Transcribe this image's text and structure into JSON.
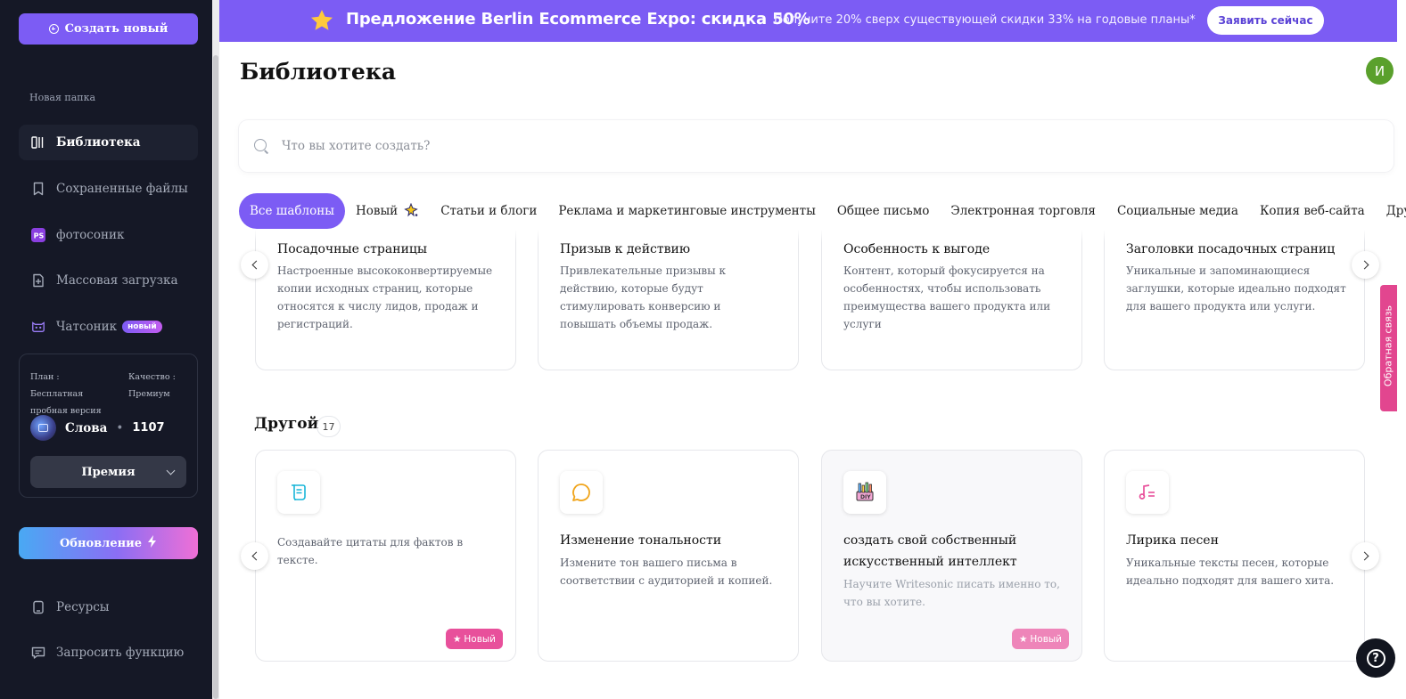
{
  "sidebar": {
    "create_button": "Создать новый",
    "folder_label": "Новая папка",
    "nav": [
      {
        "label": "Библиотека",
        "icon": "library-icon"
      },
      {
        "label": "Сохраненные файлы",
        "icon": "bookmark-icon"
      },
      {
        "label": "фотосоник",
        "icon": "photosonic-logo-icon"
      },
      {
        "label": "Массовая загрузка",
        "icon": "bulk-upload-icon"
      },
      {
        "label": "Чатсоник",
        "icon": "chatsonic-bot-icon",
        "badge": "новый"
      }
    ],
    "plan": {
      "plan_label": "План : Бесплатная пробная версия",
      "quality_label": "Качество : Премиум",
      "words_label": "Слова",
      "words_dot": "•",
      "words_count": "1107",
      "tier_select": "Премия"
    },
    "upgrade_button": "Обновление",
    "bottom_nav": [
      {
        "label": "Ресурсы",
        "icon": "resources-icon"
      },
      {
        "label": "Запросить функцию",
        "icon": "feature-request-icon"
      }
    ]
  },
  "promo": {
    "title": "Предложение Berlin Ecommerce Expo: скидка 50%",
    "subtitle": "Получите 20% сверх существующей скидки 33% на годовые планы*",
    "button": "Заявить сейчас",
    "color": "#7c5cf4"
  },
  "main": {
    "title": "Библиотека",
    "user_initial": "И",
    "search_placeholder": "Что вы хотите создать?",
    "tabs": [
      "Все шаблоны",
      "Новый",
      "Статьи и блоги",
      "Реклама и маркетинговые инструменты",
      "Общее письмо",
      "Электронная торговля",
      "Социальные медиа",
      "Копия веб-сайта",
      "Другой"
    ],
    "top_cards": [
      {
        "title": "Посадочные страницы",
        "desc": "Настроенные высококонвертируемые копии исходных страниц, которые относятся к числу лидов, продаж и регистраций."
      },
      {
        "title": "Призыв к действию",
        "desc": "Привлекательные призывы к действию, которые будут стимулировать конверсию и повышать объемы продаж."
      },
      {
        "title": "Особенность к выгоде",
        "desc": "Контент, который фокусируется на особенностях, чтобы использовать преимущества вашего продукта или услуги"
      },
      {
        "title": "Заголовки посадочных страниц",
        "desc": "Уникальные и запоминающиеся заглушки, которые идеально подходят для вашего продукта или услуги."
      }
    ],
    "section": {
      "title": "Другой",
      "count": "17"
    },
    "bottom_cards": [
      {
        "title": "",
        "desc": "Создавайте цитаты для фактов в тексте.",
        "icon": "scroll-quote-icon",
        "tag": "Новый"
      },
      {
        "title": "Изменение тональности",
        "desc": "Измените тон вашего письма в соответствии с аудиторией и копией.",
        "icon": "speech-bubble-icon"
      },
      {
        "title": "создать свой собственный искусственный интеллект",
        "desc": "Научите Writesonic писать именно то, что вы хотите.",
        "icon": "diy-tools-icon",
        "tag": "Новый"
      },
      {
        "title": "Лирика песен",
        "desc": "Уникальные тексты песен, которые идеально подходят для вашего хита.",
        "icon": "music-note-icon"
      }
    ],
    "feedback_tab": "Обратная связь",
    "help": "?"
  }
}
